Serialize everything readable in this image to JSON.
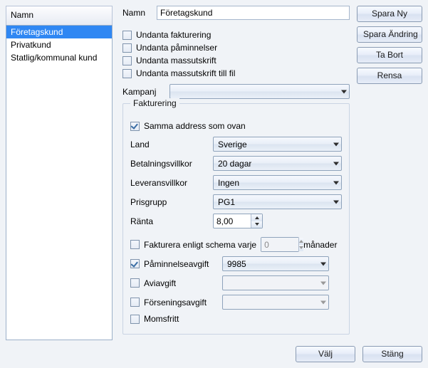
{
  "sidebar": {
    "header": "Namn",
    "items": [
      {
        "label": "Företagskund",
        "selected": true
      },
      {
        "label": "Privatkund",
        "selected": false
      },
      {
        "label": "Statlig/kommunal kund",
        "selected": false
      }
    ]
  },
  "buttons": {
    "spara_ny": "Spara Ny",
    "spara_andring": "Spara Ändring",
    "ta_bort": "Ta Bort",
    "rensa": "Rensa",
    "valj": "Välj",
    "stang": "Stäng"
  },
  "form": {
    "name_label": "Namn",
    "name_value": "Företagskund",
    "checks": {
      "undanta_fakturering": {
        "label": "Undanta fakturering",
        "checked": false
      },
      "undanta_paminnelser": {
        "label": "Undanta påminnelser",
        "checked": false
      },
      "undanta_massutskrift": {
        "label": "Undanta massutskrift",
        "checked": false
      },
      "undanta_massutskrift_fil": {
        "label": "Undanta massutskrift till fil",
        "checked": false
      }
    },
    "kampanj_label": "Kampanj",
    "kampanj_value": ""
  },
  "fakturering": {
    "legend": "Fakturering",
    "samma_address": {
      "label": "Samma address som ovan",
      "checked": true
    },
    "land": {
      "label": "Land",
      "value": "Sverige"
    },
    "betalningsvillkor": {
      "label": "Betalningsvillkor",
      "value": "20 dagar"
    },
    "leveransvillkor": {
      "label": "Leveransvillkor",
      "value": "Ingen"
    },
    "prisgrupp": {
      "label": "Prisgrupp",
      "value": "PG1"
    },
    "ranta": {
      "label": "Ränta",
      "value": "8,00"
    },
    "fakturera_schema": {
      "label": "Fakturera enligt schema varje",
      "checked": false,
      "value": "0",
      "suffix": "månader"
    },
    "paminnelseavgift": {
      "label": "Påminnelseavgift",
      "checked": true,
      "value": "9985"
    },
    "aviavgift": {
      "label": "Aviavgift",
      "checked": false,
      "value": ""
    },
    "forseningsavgift": {
      "label": "Förseningsavgift",
      "checked": false,
      "value": ""
    },
    "momsfritt": {
      "label": "Momsfritt",
      "checked": false
    }
  }
}
